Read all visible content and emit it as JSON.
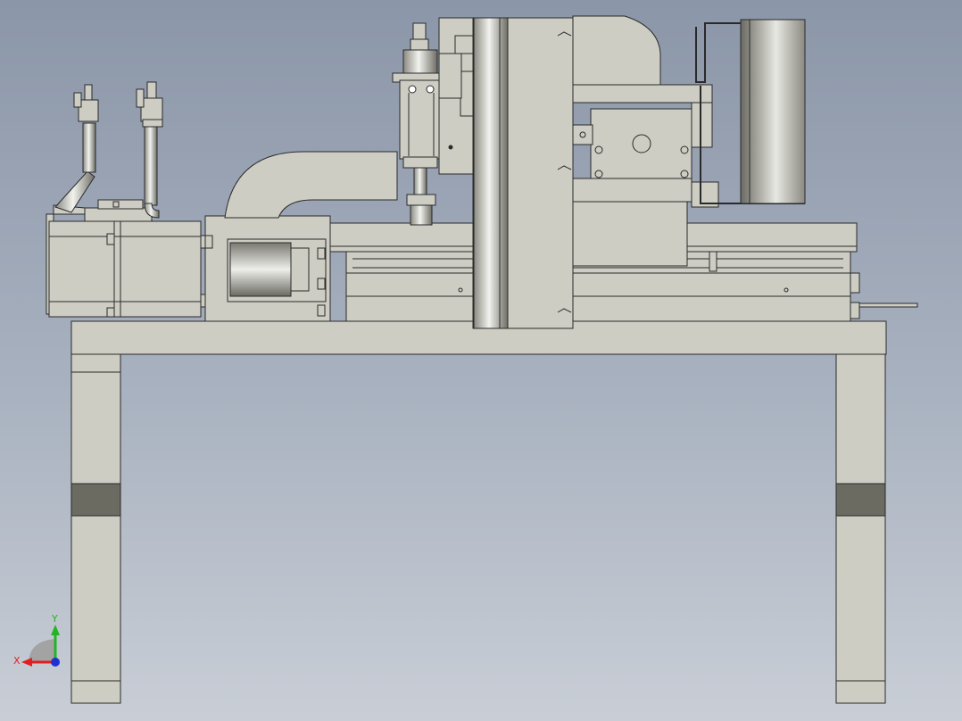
{
  "scene": {
    "description_type": "cad-front-view",
    "colors": {
      "background_top": "#8b96a8",
      "background_bottom": "#c9ced6",
      "part_fill": "#cdcdc4",
      "part_outline": "#2a2a2a",
      "band_dark": "#6b6b62"
    }
  },
  "triad": {
    "x_label": "X",
    "y_label": "Y",
    "x_color": "#e02020",
    "y_color": "#22b422",
    "z_color": "#2030d0"
  }
}
